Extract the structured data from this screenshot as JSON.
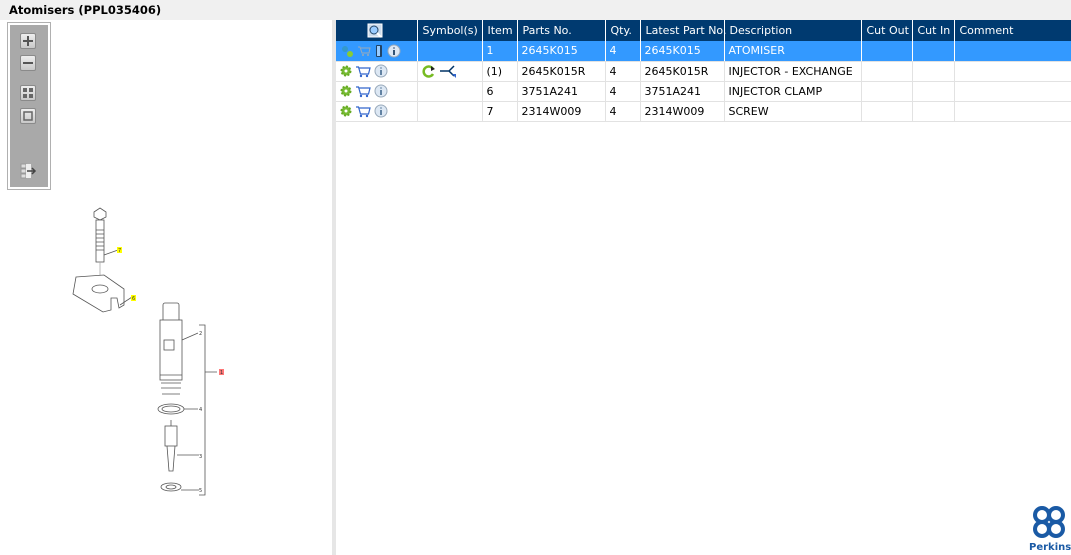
{
  "title": "Atomisers (PPL035406)",
  "toolbar": [
    "zoom-in",
    "zoom-out",
    "fit-all",
    "fit-window",
    "expand-panel"
  ],
  "diagram_callouts": [
    "7",
    "6",
    "2",
    "1",
    "4",
    "3",
    "5"
  ],
  "table": {
    "headers": [
      "",
      "Symbol(s)",
      "Item",
      "Parts No.",
      "Qty.",
      "Latest Part No.",
      "Description",
      "Cut Out",
      "Cut In",
      "Comment"
    ],
    "rows": [
      {
        "item": "1",
        "parts_no": "2645K015",
        "qty": "4",
        "latest": "2645K015",
        "desc": "ATOMISER",
        "cut_out": "",
        "cut_in": "",
        "comment": "",
        "selected": true
      },
      {
        "item": "(1)",
        "parts_no": "2645K015R",
        "qty": "4",
        "latest": "2645K015R",
        "desc": "INJECTOR - EXCHANGE",
        "cut_out": "",
        "cut_in": "",
        "comment": "",
        "symbols": [
          "exchange-icon",
          "supersession-icon"
        ]
      },
      {
        "item": "6",
        "parts_no": "3751A241",
        "qty": "4",
        "latest": "3751A241",
        "desc": "INJECTOR CLAMP",
        "cut_out": "",
        "cut_in": "",
        "comment": ""
      },
      {
        "item": "7",
        "parts_no": "2314W009",
        "qty": "4",
        "latest": "2314W009",
        "desc": "SCREW",
        "cut_out": "",
        "cut_in": "",
        "comment": ""
      }
    ]
  },
  "logo": {
    "text": "Perkins"
  },
  "colors": {
    "header": "#003a70",
    "selected": "#3399ff",
    "logo": "#1a5aa5"
  }
}
